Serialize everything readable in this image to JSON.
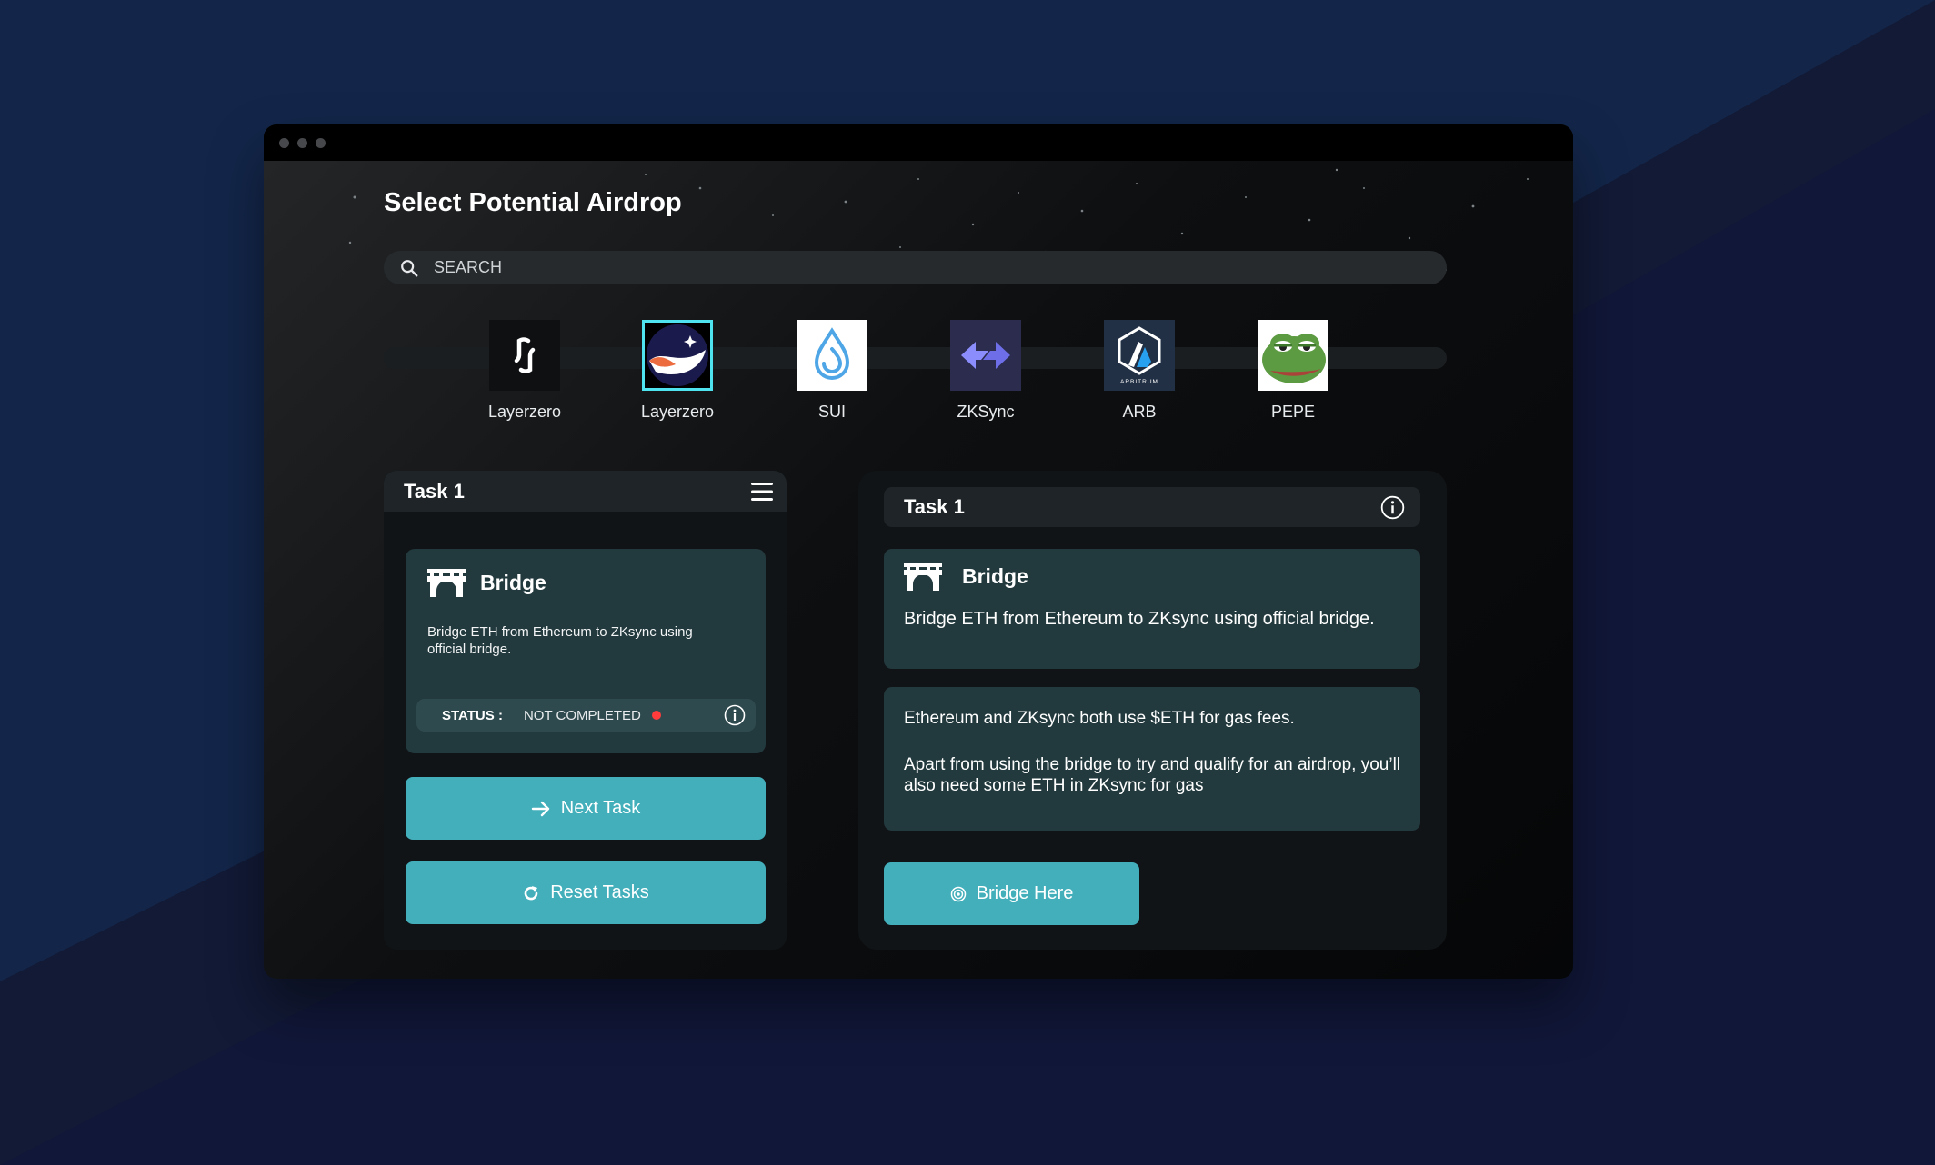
{
  "colors": {
    "accent": "#43afbb",
    "selected_border": "#4ee3ee",
    "card": "#22393d",
    "status_not_completed": "#ff3b3b"
  },
  "header": {
    "title": "Select Potential Airdrop"
  },
  "search": {
    "placeholder": "SEARCH",
    "value": ""
  },
  "tokens": [
    {
      "name": "Layerzero",
      "icon": "layerzero-logo",
      "selected": false
    },
    {
      "name": "Layerzero",
      "icon": "starknet-logo",
      "selected": true
    },
    {
      "name": "SUI",
      "icon": "sui-drop-logo",
      "selected": false
    },
    {
      "name": "ZKSync",
      "icon": "zksync-arrows-logo",
      "selected": false
    },
    {
      "name": "ARB",
      "icon": "arbitrum-logo",
      "selected": false,
      "logo_text": "ARBITRUM"
    },
    {
      "name": "PEPE",
      "icon": "pepe-frog-logo",
      "selected": false
    }
  ],
  "task_panel": {
    "title": "Task 1",
    "menu_icon": "hamburger-menu-icon",
    "card": {
      "icon": "bridge-icon",
      "title": "Bridge",
      "description": "Bridge ETH from Ethereum to ZKsync using official bridge.",
      "status_label": "STATUS :",
      "status_value": "NOT COMPLETED",
      "info_icon": "info-icon"
    },
    "next_button": "Next Task",
    "reset_button": "Reset Tasks"
  },
  "detail_panel": {
    "title": "Task 1",
    "info_icon": "info-icon",
    "card": {
      "icon": "bridge-icon",
      "title": "Bridge",
      "description": "Bridge ETH from Ethereum to ZKsync using official bridge."
    },
    "info_paragraph_1": "Ethereum and ZKsync both use $ETH for gas fees.",
    "info_paragraph_2": "Apart from using the bridge to try and qualify for an airdrop, you’ll also need some ETH in ZKsync for gas",
    "bridge_button": "Bridge Here"
  }
}
